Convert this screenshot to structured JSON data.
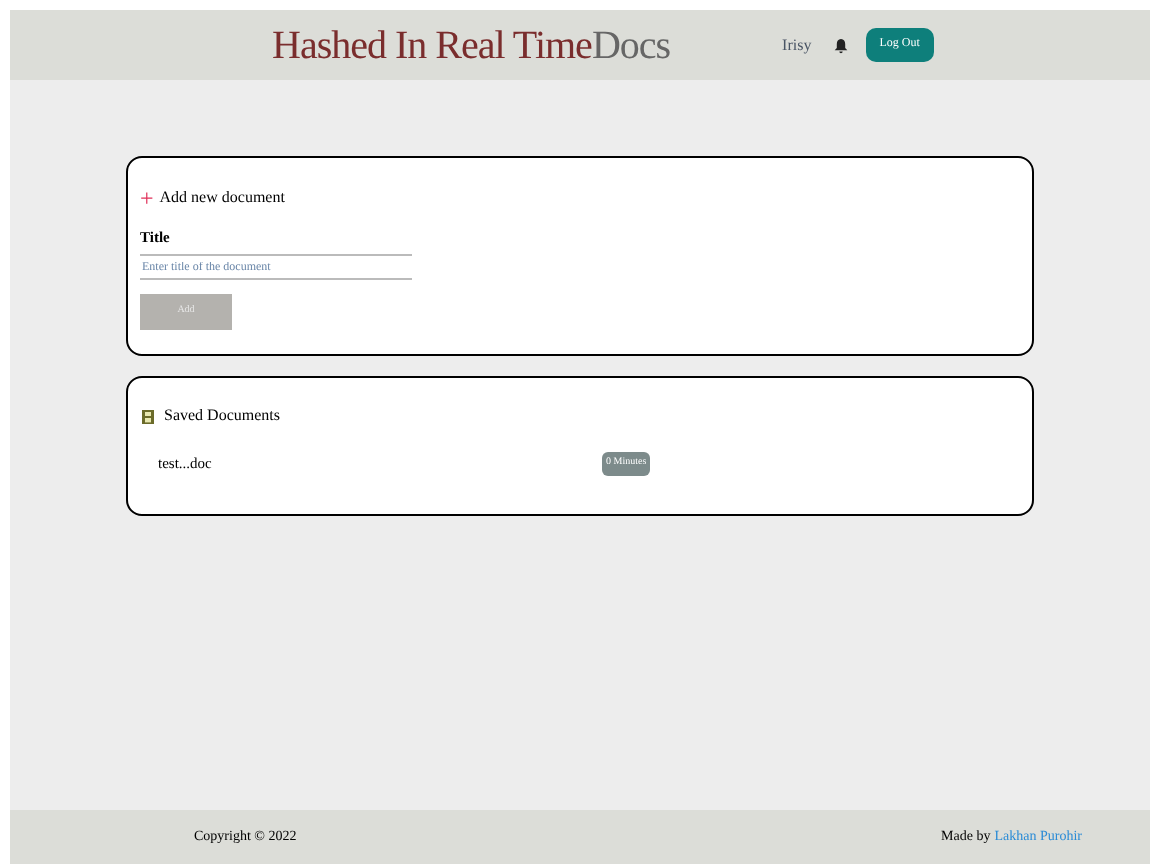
{
  "header": {
    "title_main": "Hashed In Real Time",
    "title_accent": "Docs",
    "username": "Irisy",
    "logout_button": "Log Out"
  },
  "add_document": {
    "icon": "+",
    "heading": "Add new document",
    "field_label": "Title",
    "placeholder": "Enter title of the document",
    "button": "Add",
    "button_disabled": true
  },
  "saved_documents": {
    "heading": "Saved Documents",
    "documents": [
      {
        "name": "test...doc",
        "badge": "0 Minutes"
      }
    ]
  },
  "footer": {
    "copyright": "Copyright © 2022",
    "made_by": "Made by",
    "author": "Lakhan Purohir"
  }
}
